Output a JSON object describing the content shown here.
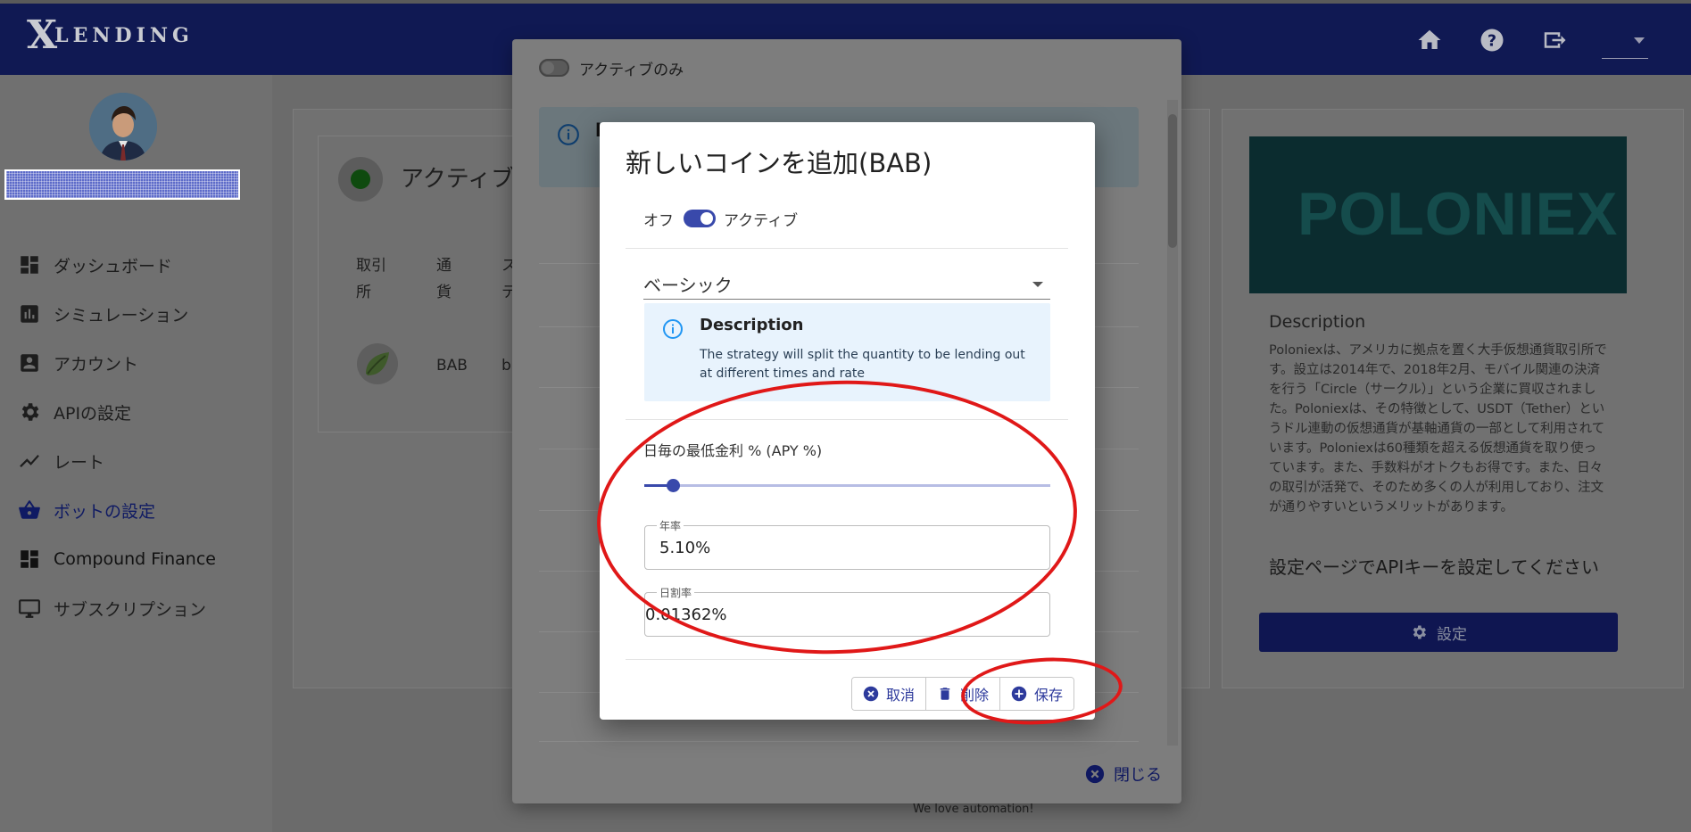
{
  "app": {
    "logo_x": "X",
    "logo_rest": "LENDING"
  },
  "topbar": {
    "icons": [
      "home-icon",
      "help-icon",
      "logout-icon",
      "dropdown-icon"
    ]
  },
  "sidebar": {
    "items": [
      {
        "label": "ダッシュボード",
        "icon": "dashboard-icon"
      },
      {
        "label": "シミュレーション",
        "icon": "chart-icon"
      },
      {
        "label": "アカウント",
        "icon": "account-icon"
      },
      {
        "label": "APIの設定",
        "icon": "gear-icon"
      },
      {
        "label": "レート",
        "icon": "trend-icon"
      },
      {
        "label": "ボットの設定",
        "icon": "basket-icon"
      },
      {
        "label": "Compound Finance",
        "icon": "dashboard-icon"
      },
      {
        "label": "サブスクリプション",
        "icon": "monitor-icon"
      }
    ]
  },
  "active_card": {
    "title": "アクティブ",
    "headers": [
      "取引\n所",
      "通\n貨",
      "ス\nテ"
    ],
    "row": {
      "currency": "BAB",
      "partial": "b"
    }
  },
  "right_panel": {
    "logo_text": "POLONIEX",
    "desc_title": "Description",
    "desc_text": "Poloniexは、アメリカに拠点を置く大手仮想通貨取引所です。設立は2014年で、2018年2月、モバイル関連の決済を行う「Circle（サークル）」という企業に買収されました。Poloniexは、その特徴として、USDT（Tether）というドル連動の仮想通貨が基軸通貨の一部として利用されています。Poloniexは60種類を超える仮想通貨を取り使っています。また、手数料がオトクもお得です。また、日々の取引が活発で、そのため多くの人が利用しており、注文が通りやすいというメリットがあります。",
    "api_note": "設定ページでAPIキーを設定してください",
    "setting_button": "設定"
  },
  "footer": {
    "text": "We love automation!"
  },
  "mid_dialog": {
    "toggle_label": "アクティブのみ",
    "info_partial": "b",
    "close_label": "閉じる"
  },
  "modal": {
    "title": "新しいコインを追加(BAB)",
    "off_label": "オフ",
    "active_label": "アクティブ",
    "strategy_selected": "ベーシック",
    "desc_title": "Description",
    "desc_text": "The strategy will split the quantity to be lending out at different times and rate",
    "apy_label": "日毎の最低金利 % (APY %)",
    "slider_fraction": 0.07,
    "annual_label": "年率",
    "annual_value": "5.10%",
    "daily_label": "日割率",
    "daily_value": "0.01362%",
    "cancel_label": "取消",
    "delete_label": "削除",
    "save_label": "保存"
  },
  "colors": {
    "navy": "#101953",
    "accent": "#3949ab",
    "highlight": "#e01818",
    "info_bg": "#e8f3fd"
  }
}
